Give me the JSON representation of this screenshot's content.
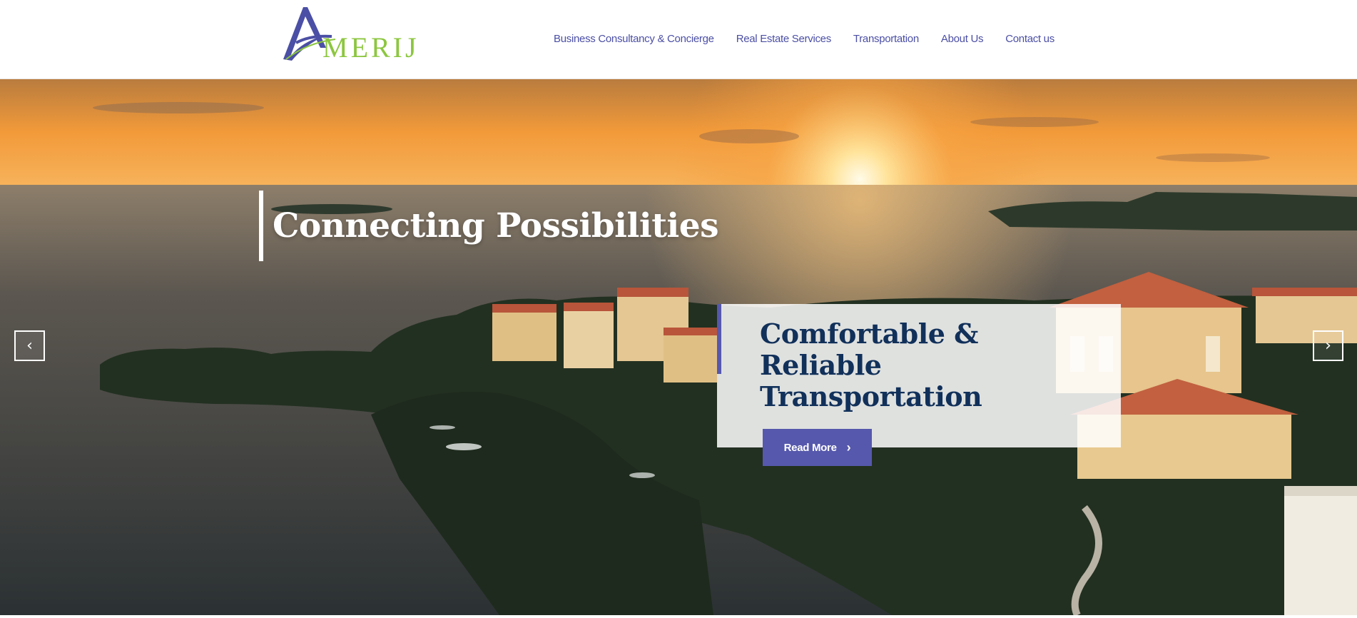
{
  "brand": {
    "logo_text": "MERIJ",
    "logo_alt": "Amerij"
  },
  "nav": {
    "items": [
      "Business Consultancy & Concierge",
      "Real Estate Services",
      "Transportation",
      "About Us",
      "Contact us"
    ]
  },
  "hero": {
    "tagline": "Connecting Possibilities",
    "card": {
      "title": "Comfortable & Reliable Transportation",
      "button_label": "Read More"
    },
    "prev_icon": "chevron-left-icon",
    "next_icon": "chevron-right-icon"
  },
  "colors": {
    "brand_purple": "#5658ad",
    "brand_green": "#8cc63f",
    "nav_text": "#4b4fa5",
    "card_title": "#11305a"
  }
}
